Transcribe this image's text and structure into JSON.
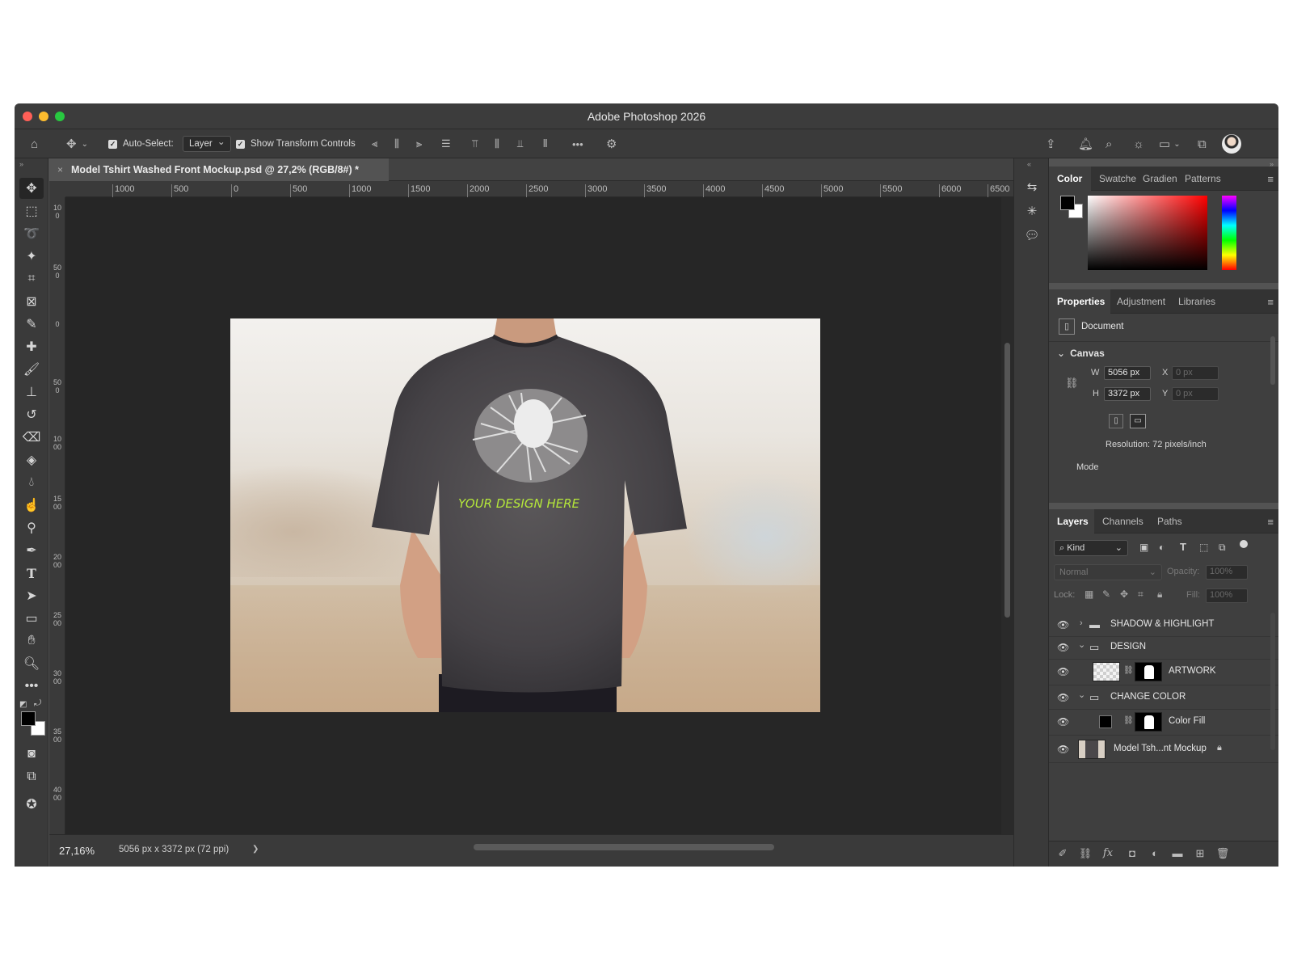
{
  "window": {
    "title": "Adobe Photoshop 2026"
  },
  "options_bar": {
    "auto_select_label": "Auto-Select:",
    "auto_select_value": "Layer",
    "show_transform_label": "Show Transform Controls",
    "more_label": "•••"
  },
  "document": {
    "tab_title": "Model Tshirt Washed Front Mockup.psd @ 27,2% (RGB/8#) *",
    "close_glyph": "×",
    "ruler_h": [
      "1000",
      "500",
      "0",
      "500",
      "1000",
      "1500",
      "2000",
      "2500",
      "3000",
      "3500",
      "4000",
      "4500",
      "5000",
      "5500",
      "6000",
      "6500"
    ],
    "ruler_v": [
      "100",
      "500",
      "0",
      "500",
      "1000",
      "1500",
      "2000",
      "2500",
      "3000",
      "3500",
      "4000"
    ],
    "shirt_print_text": "YOUR DESIGN HERE"
  },
  "status": {
    "zoom": "27,16%",
    "info": "5056 px x 3372 px (72 ppi)",
    "arrow": "❯"
  },
  "color_panel": {
    "tabs": [
      "Color",
      "Swatche",
      "Gradien",
      "Patterns"
    ],
    "foreground": "#000000",
    "background": "#ffffff"
  },
  "properties_panel": {
    "tabs": [
      "Properties",
      "Adjustment",
      "Libraries"
    ],
    "doc_label": "Document",
    "canvas_label": "Canvas",
    "w_label": "W",
    "w_value": "5056 px",
    "h_label": "H",
    "h_value": "3372 px",
    "x_label": "X",
    "x_placeholder": "0 px",
    "y_label": "Y",
    "y_placeholder": "0 px",
    "resolution": "Resolution: 72 pixels/inch",
    "mode_label": "Mode"
  },
  "layers_panel": {
    "tabs": [
      "Layers",
      "Channels",
      "Paths"
    ],
    "kind_label": "Kind",
    "blend_mode": "Normal",
    "opacity_label": "Opacity:",
    "opacity_value": "100%",
    "lock_label": "Lock:",
    "fill_label": "Fill:",
    "fill_value": "100%",
    "layers": [
      {
        "name": "SHADOW & HIGHLIGHT",
        "type": "group",
        "expanded": false
      },
      {
        "name": "DESIGN",
        "type": "group",
        "expanded": true
      },
      {
        "name": "ARTWORK",
        "type": "smart"
      },
      {
        "name": "CHANGE COLOR",
        "type": "group",
        "expanded": true
      },
      {
        "name": "Color Fill",
        "type": "fill"
      },
      {
        "name": "Model Tsh...nt Mockup",
        "type": "image",
        "locked": true
      }
    ]
  },
  "colors": {
    "accent": "#2e7bd6",
    "print_green": "#b5e83a"
  }
}
